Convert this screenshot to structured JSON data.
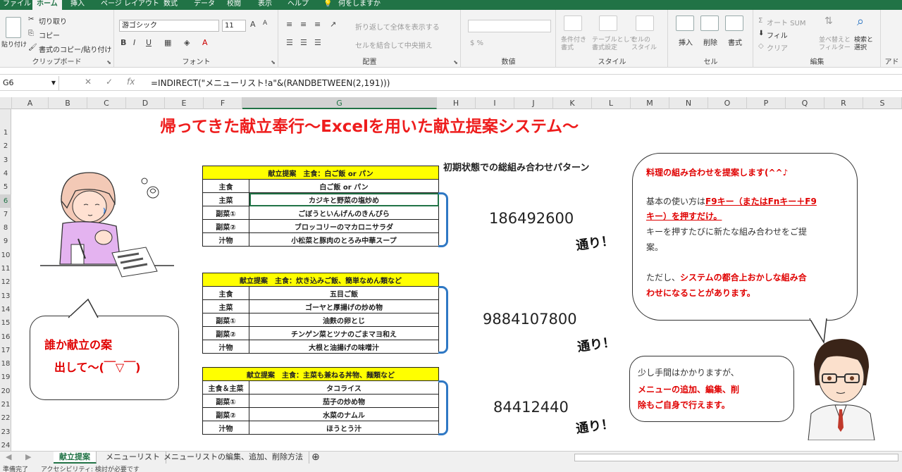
{
  "menu_tabs": [
    "ファイル",
    "ホーム",
    "挿入",
    "ページ レイアウト",
    "数式",
    "データ",
    "校閲",
    "表示",
    "ヘルプ"
  ],
  "tell_me": "何をしますか",
  "ribbon": {
    "clipboard": {
      "paste": "貼り付け",
      "cut": "切り取り",
      "copy": "コピー",
      "format_painter": "書式のコピー/貼り付け",
      "label": "クリップボード"
    },
    "font": {
      "font_name": "游ゴシック",
      "font_size": "11",
      "label": "フォント"
    },
    "alignment": {
      "wrap": "折り返して全体を表示する",
      "merge": "セルを結合して中央揃え",
      "label": "配置"
    },
    "number": {
      "label": "数値"
    },
    "styles": {
      "conditional": "条件付き\n書式",
      "table": "テーブルとして\n書式設定",
      "cell_styles": "セルの\nスタイル",
      "label": "スタイル"
    },
    "cells": {
      "insert": "挿入",
      "delete": "削除",
      "format": "書式",
      "label": "セル"
    },
    "editing": {
      "autosum": "オート SUM",
      "fill": "フィル",
      "clear": "クリア",
      "sort": "並べ替えと\nフィルター",
      "find": "検索と\n選択",
      "label": "編集"
    },
    "addins": {
      "label": "アド"
    }
  },
  "formula_bar": {
    "name_box": "G6",
    "formula": "=INDIRECT(\"メニューリスト!a\"&(RANDBETWEEN(2,191)))"
  },
  "columns": [
    "A",
    "B",
    "C",
    "D",
    "E",
    "F",
    "G",
    "H",
    "I",
    "J",
    "K",
    "L",
    "M",
    "N",
    "O",
    "P",
    "Q",
    "R",
    "S"
  ],
  "selected_column": "G",
  "rows": [
    "1",
    "2",
    "3",
    "4",
    "5",
    "6",
    "7",
    "8",
    "9",
    "10",
    "11",
    "12",
    "13",
    "14",
    "15",
    "16",
    "17",
    "18",
    "19",
    "20",
    "21",
    "22",
    "23",
    "24"
  ],
  "selected_row": "6",
  "sheet": {
    "title": "帰ってきた献立奉行～Excelを用いた献立提案システム～",
    "subheading": "初期状態での総組み合わせパターン",
    "tables": [
      {
        "header": "献立提案　主食：白ご飯 or パン",
        "rows": [
          [
            "主食",
            "白ご飯 or パン"
          ],
          [
            "主菜",
            "カジキと野菜の塩炒め"
          ],
          [
            "副菜①",
            "ごぼうといんげんのきんぴら"
          ],
          [
            "副菜②",
            "ブロッコリーのマカロニサラダ"
          ],
          [
            "汁物",
            "小松菜と豚肉のとろみ中華スープ"
          ]
        ],
        "count": "186492600",
        "suffix": "通り！"
      },
      {
        "header": "献立提案　主食：炊き込みご飯、簡単なめん類など",
        "rows": [
          [
            "主食",
            "五目ご飯"
          ],
          [
            "主菜",
            "ゴーヤと厚揚げの炒め物"
          ],
          [
            "副菜①",
            "油麩の卵とじ"
          ],
          [
            "副菜②",
            "チンゲン菜とツナのごまマヨ和え"
          ],
          [
            "汁物",
            "大根と油揚げの味噌汁"
          ]
        ],
        "count": "9884107800",
        "suffix": "通り！"
      },
      {
        "header": "献立提案　主食：主菜も兼ねる丼物、麺類など",
        "rows": [
          [
            "主食＆主菜",
            "タコライス"
          ],
          [
            "副菜①",
            "茄子の炒め物"
          ],
          [
            "副菜②",
            "水菜のナムル"
          ],
          [
            "汁物",
            "ほうとう汁"
          ]
        ],
        "count": "84412440",
        "suffix": "通り！"
      }
    ],
    "left_bubble": {
      "line1": "誰か献立の案",
      "line2": "出して～(￣▽￣)"
    },
    "right_bubble": {
      "line1": "料理の組み合わせを提案します(^^♪",
      "line2a": "基本の使い方は",
      "line2b": "F9キー（またはFnキー＋F9",
      "line3a": "キー）を押すだけ。",
      "line4": "キーを押すたびに新たな組み合わせをご提",
      "line5": "案。",
      "line6a": "ただし、",
      "line6b": "システムの都合上おかしな組み合",
      "line7": "わせになることがあります。"
    },
    "bottom_bubble": {
      "line1": "少し手間はかかりますが、",
      "line2": "メニューの追加、編集、削",
      "line3": "除もご自身で行えます。"
    }
  },
  "sheet_tabs": [
    "献立提案",
    "メニューリスト",
    "メニューリストの編集、追加、削除方法"
  ],
  "active_sheet": "献立提案",
  "status": {
    "ready": "準備完了",
    "accessibility": "アクセシビリティ: 検討が必要です"
  },
  "colors": {
    "excel_green": "#217346",
    "title_red": "#ee1c1c",
    "header_yellow": "#ffff00",
    "brace_blue": "#2f78c4"
  }
}
